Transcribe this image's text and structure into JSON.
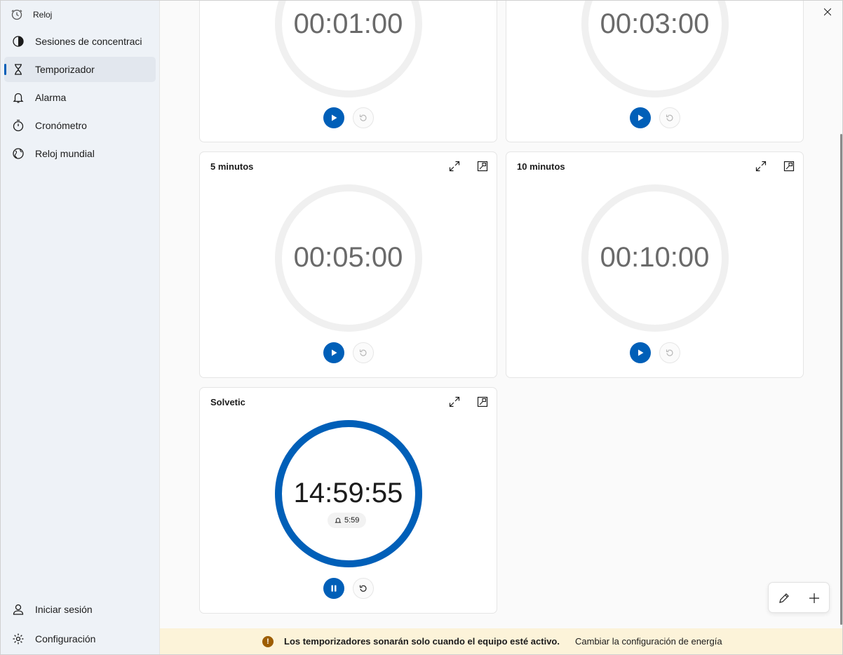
{
  "app": {
    "title": "Reloj",
    "icon": "clock-app-icon"
  },
  "sidebar": {
    "items": [
      {
        "label": "Sesiones de concentración",
        "icon": "focus-icon",
        "active": false
      },
      {
        "label": "Temporizador",
        "icon": "hourglass-icon",
        "active": true
      },
      {
        "label": "Alarma",
        "icon": "bell-icon",
        "active": false
      },
      {
        "label": "Cronómetro",
        "icon": "stopwatch-icon",
        "active": false
      },
      {
        "label": "Reloj mundial",
        "icon": "globe-icon",
        "active": false
      }
    ],
    "footer": [
      {
        "label": "Iniciar sesión",
        "icon": "person-icon"
      },
      {
        "label": "Configuración",
        "icon": "gear-icon"
      }
    ]
  },
  "window_controls": [
    "minimize-icon",
    "maximize-icon",
    "close-icon"
  ],
  "timers": [
    {
      "name": "",
      "time": "00:01:00",
      "running": false
    },
    {
      "name": "",
      "time": "00:03:00",
      "running": false
    },
    {
      "name": "5 minutos",
      "time": "00:05:00",
      "running": false
    },
    {
      "name": "10 minutos",
      "time": "00:10:00",
      "running": false
    },
    {
      "name": "Solvetic",
      "time": "14:59:55",
      "running": true,
      "alarm_time": "5:59",
      "progress": 1.0
    }
  ],
  "fab": {
    "edit_icon": "pencil-icon",
    "add_icon": "plus-icon"
  },
  "infobar": {
    "message": "Los temporizadores sonarán solo cuando el equipo esté activo.",
    "link": "Cambiar la configuración de energía"
  },
  "colors": {
    "accent": "#005fb8",
    "warning": "#9d5d00",
    "infobar_bg": "#fcf3d9"
  }
}
